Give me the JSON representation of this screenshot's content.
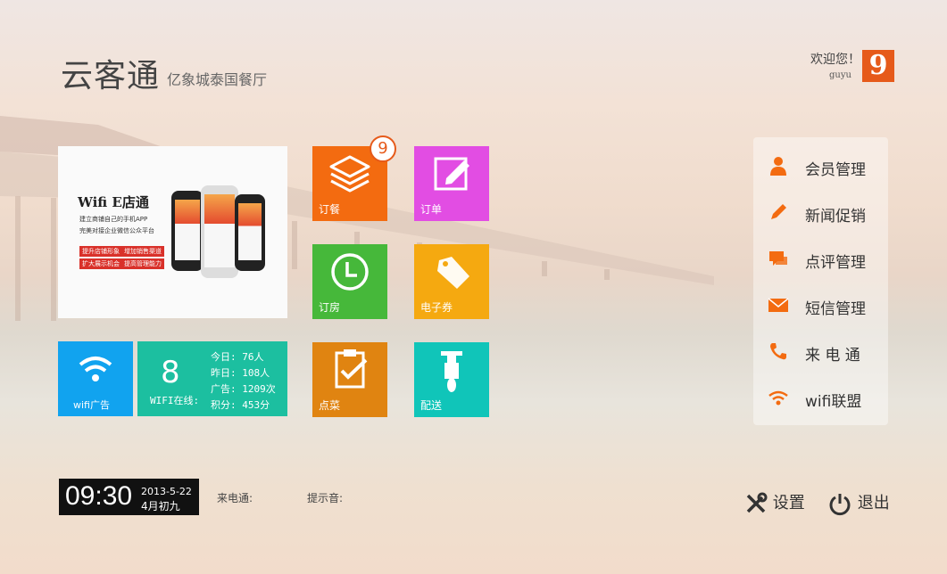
{
  "header": {
    "app_name": "云客通",
    "subtitle": "亿象城泰国餐厅"
  },
  "user": {
    "welcome": "欢迎您！",
    "name": "guyu",
    "avatar_text": "9"
  },
  "banner": {
    "title": "Wifi E店通",
    "line1": "建立商铺自己的手机APP",
    "line2": "完美对接企业微信公众平台",
    "tags": [
      "提升店铺形象",
      "增加销售渠道",
      "扩大展示机会",
      "提高管理能力"
    ]
  },
  "tiles": {
    "order_meal": "订餐",
    "order_meal_badge": "9",
    "order": "订单",
    "order_room": "订房",
    "coupon": "电子券",
    "pick_dish": "点菜",
    "delivery": "配送",
    "wifi_ad": "wifi广告"
  },
  "wifi_stats": {
    "online_count": "8",
    "online_label": "WIFI在线:",
    "today": "今日: 76人",
    "yesterday": "昨日: 108人",
    "ads": "广告: 1209次",
    "points": "积分: 453分"
  },
  "menu": {
    "items": [
      {
        "label": "会员管理",
        "icon": "person-icon"
      },
      {
        "label": "新闻促销",
        "icon": "pencil-icon"
      },
      {
        "label": "点评管理",
        "icon": "chat-icon"
      },
      {
        "label": "短信管理",
        "icon": "envelope-icon"
      },
      {
        "label": "来 电 通",
        "icon": "phone-icon"
      },
      {
        "label": "wifi联盟",
        "icon": "wifi-icon"
      }
    ]
  },
  "footer": {
    "time": "09:30",
    "date": "2013-5-22",
    "lunar": "4月初九",
    "incoming_label": "来电通:",
    "prompt_label": "提示音:",
    "settings": "设置",
    "logout": "退出"
  },
  "colors": {
    "orange": "#f36b10",
    "pink": "#e24de3",
    "green": "#46b83a",
    "amber": "#f5a910",
    "dark_orange": "#e08411",
    "teal": "#10c5b9",
    "blue": "#11a3ef",
    "stats_teal": "#1cbfa0"
  }
}
